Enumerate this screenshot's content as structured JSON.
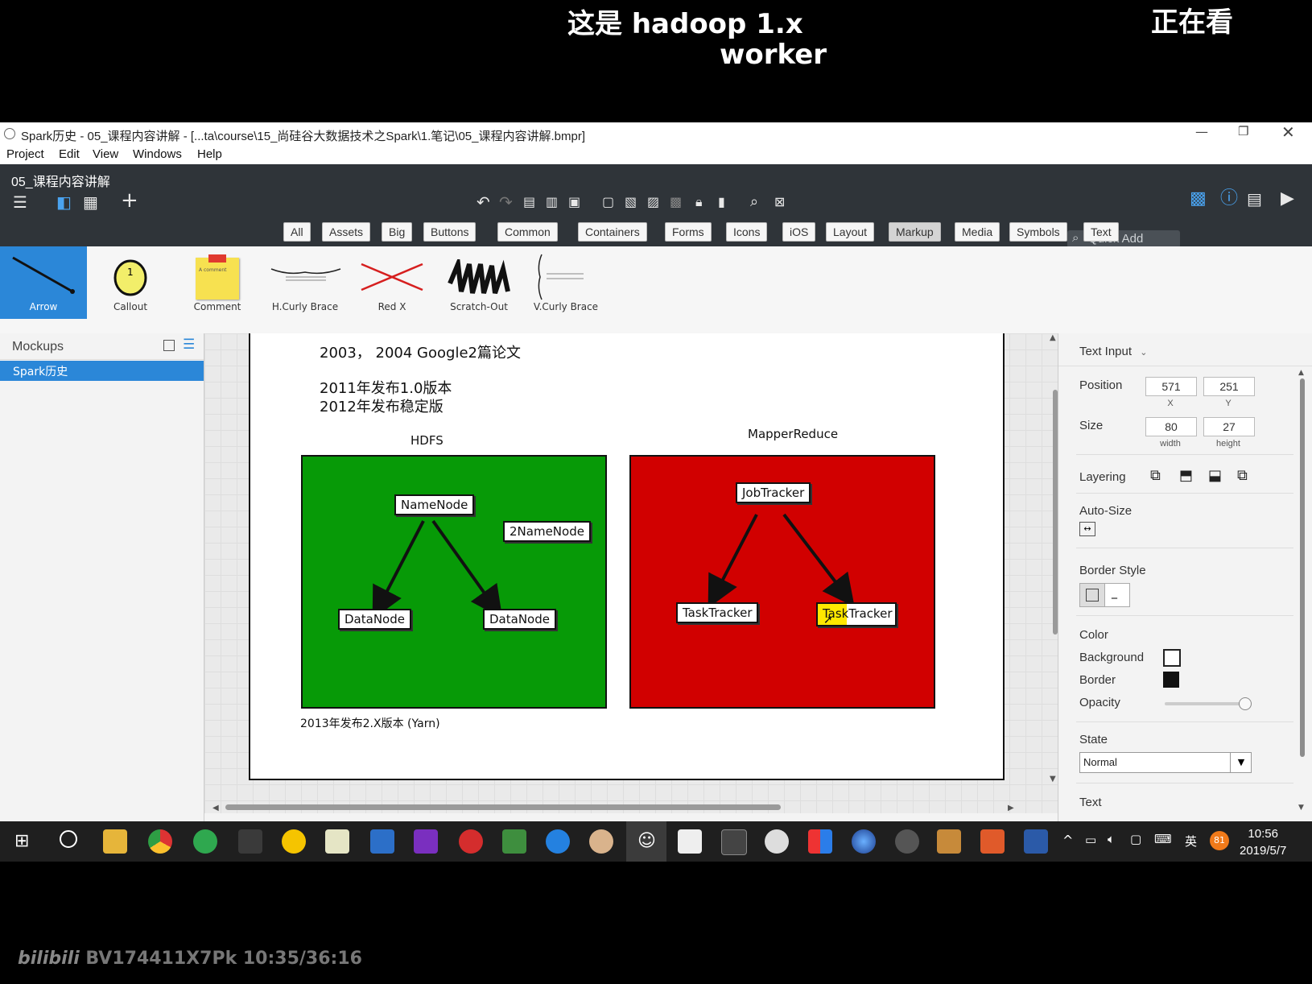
{
  "captions": {
    "line1": "这是 hadoop 1.x",
    "line2": "worker",
    "watching": "正在看"
  },
  "window": {
    "title": "Spark历史 - 05_课程内容讲解 - [...ta\\course\\15_尚硅谷大数据技术之Spark\\1.笔记\\05_课程内容讲解.bmpr]",
    "menu": [
      "Project",
      "Edit",
      "View",
      "Windows",
      "Help"
    ],
    "doc_title": "05_课程内容讲解",
    "quick_add": "Quick Add"
  },
  "filter_tabs": [
    "All",
    "Assets",
    "Big",
    "Buttons",
    "Common",
    "Containers",
    "Forms",
    "Icons",
    "iOS",
    "Layout",
    "Markup",
    "Media",
    "Symbols",
    "Text"
  ],
  "active_filter": "Markup",
  "palette": [
    "Arrow",
    "Callout",
    "Comment",
    "H.Curly Brace",
    "Red X",
    "Scratch-Out",
    "V.Curly Brace"
  ],
  "palette_callout_number": "1",
  "palette_comment_text": "A comment",
  "left_panel": {
    "title": "Mockups",
    "items": [
      "Spark历史"
    ]
  },
  "canvas": {
    "line1": "2003，  2004 Google2篇论文",
    "line2": "2011年发布1.0版本",
    "line3": " 2012年发布稳定版",
    "hdfs_label": "HDFS",
    "mr_label": "MapperReduce",
    "hdfs_nodes": {
      "namenode": "NameNode",
      "secondary": "2NameNode",
      "datanode1": "DataNode",
      "datanode2": "DataNode"
    },
    "mr_nodes": {
      "jobtracker": "JobTracker",
      "tasktracker1": "TaskTracker",
      "tasktracker2": "TaskTracker"
    },
    "footer": "2013年发布2.X版本 (Yarn)",
    "hdfs_color": "#079a07",
    "mr_color": "#d10000"
  },
  "properties": {
    "type": "Text Input",
    "position_label": "Position",
    "x": "571",
    "y": "251",
    "x_label": "X",
    "y_label": "Y",
    "size_label": "Size",
    "width": "80",
    "height": "27",
    "width_label": "width",
    "height_label": "height",
    "layering": "Layering",
    "auto_size": "Auto-Size",
    "border_style": "Border Style",
    "color": "Color",
    "background": "Background",
    "border": "Border",
    "opacity": "Opacity",
    "state": "State",
    "state_value": "Normal",
    "text": "Text"
  },
  "taskbar": {
    "time": "10:56",
    "date": "2019/5/7",
    "ime": "英",
    "badge": "81"
  },
  "watermark": "BV174411X7Pk 10:35/36:16",
  "watermark_logo": "bilibili"
}
